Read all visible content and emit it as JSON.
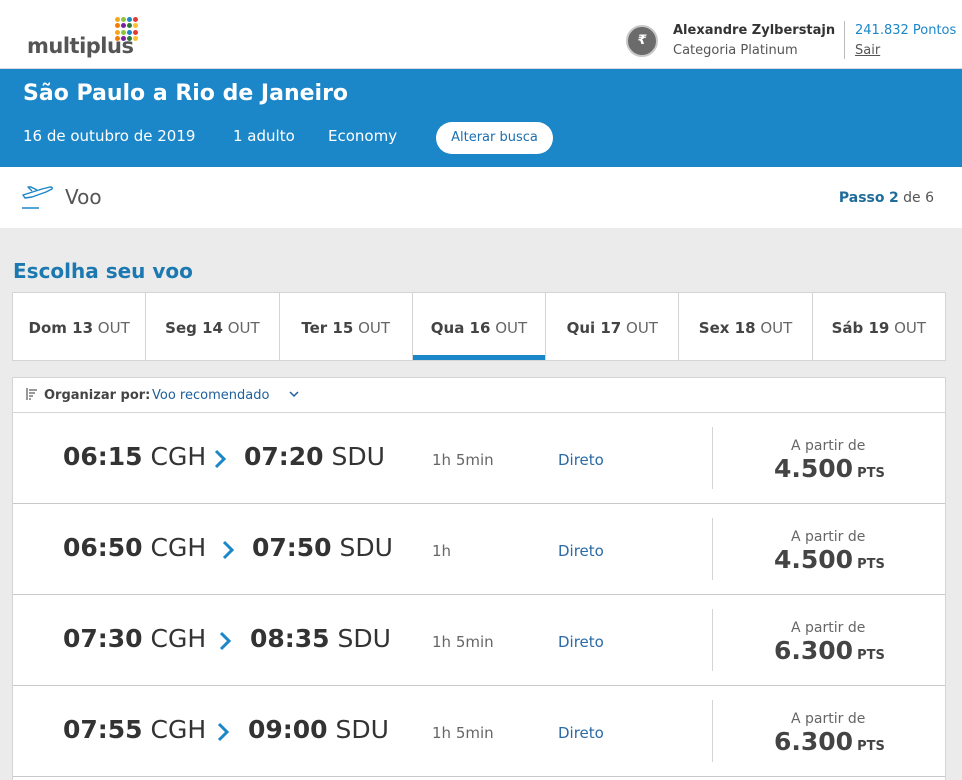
{
  "header": {
    "logo_text": "multiplus",
    "logo_colors": [
      "#f6a81c",
      "#8cc63f",
      "#1b86c8",
      "#e53935",
      "#f57c00",
      "#7b1fa2",
      "#2e7d32",
      "#fbc02d"
    ],
    "avatar_icon": "multiplus-badge-icon",
    "user_name": "Alexandre Zylberstajn",
    "user_category": "Categoria Platinum",
    "points": "241.832 Pontos",
    "logout_label": "Sair"
  },
  "search": {
    "route": "São Paulo a Rio de Janeiro",
    "date": "16 de outubro de 2019",
    "passengers": "1 adulto",
    "cabin": "Economy",
    "change_label": "Alterar busca"
  },
  "step": {
    "icon": "plane-icon",
    "title": "Voo",
    "label": "Passo",
    "current": "2",
    "of_text": "de 6"
  },
  "section_title": "Escolha seu voo",
  "date_tabs": [
    {
      "day": "Dom 13",
      "month": "OUT",
      "active": false
    },
    {
      "day": "Seg 14",
      "month": "OUT",
      "active": false
    },
    {
      "day": "Ter 15",
      "month": "OUT",
      "active": false
    },
    {
      "day": "Qua 16",
      "month": "OUT",
      "active": true
    },
    {
      "day": "Qui 17",
      "month": "OUT",
      "active": false
    },
    {
      "day": "Sex 18",
      "month": "OUT",
      "active": false
    },
    {
      "day": "Sáb 19",
      "month": "OUT",
      "active": false
    }
  ],
  "sort": {
    "label": "Organizar por:",
    "value": "Voo recomendado"
  },
  "flights": [
    {
      "dep_time": "06:15",
      "dep_airport": "CGH",
      "arr_time": "07:20",
      "arr_airport": "SDU",
      "duration": "1h 5min",
      "stops": "Direto",
      "from_label": "A partir de",
      "price": "4.500",
      "unit": "PTS"
    },
    {
      "dep_time": "06:50",
      "dep_airport": "CGH",
      "arr_time": "07:50",
      "arr_airport": "SDU",
      "duration": "1h",
      "stops": "Direto",
      "from_label": "A partir de",
      "price": "4.500",
      "unit": "PTS"
    },
    {
      "dep_time": "07:30",
      "dep_airport": "CGH",
      "arr_time": "08:35",
      "arr_airport": "SDU",
      "duration": "1h 5min",
      "stops": "Direto",
      "from_label": "A partir de",
      "price": "6.300",
      "unit": "PTS"
    },
    {
      "dep_time": "07:55",
      "dep_airport": "CGH",
      "arr_time": "09:00",
      "arr_airport": "SDU",
      "duration": "1h 5min",
      "stops": "Direto",
      "from_label": "A partir de",
      "price": "6.300",
      "unit": "PTS"
    }
  ],
  "colors": {
    "brand_blue": "#1b86c8",
    "link_blue": "#2a6aa5"
  }
}
